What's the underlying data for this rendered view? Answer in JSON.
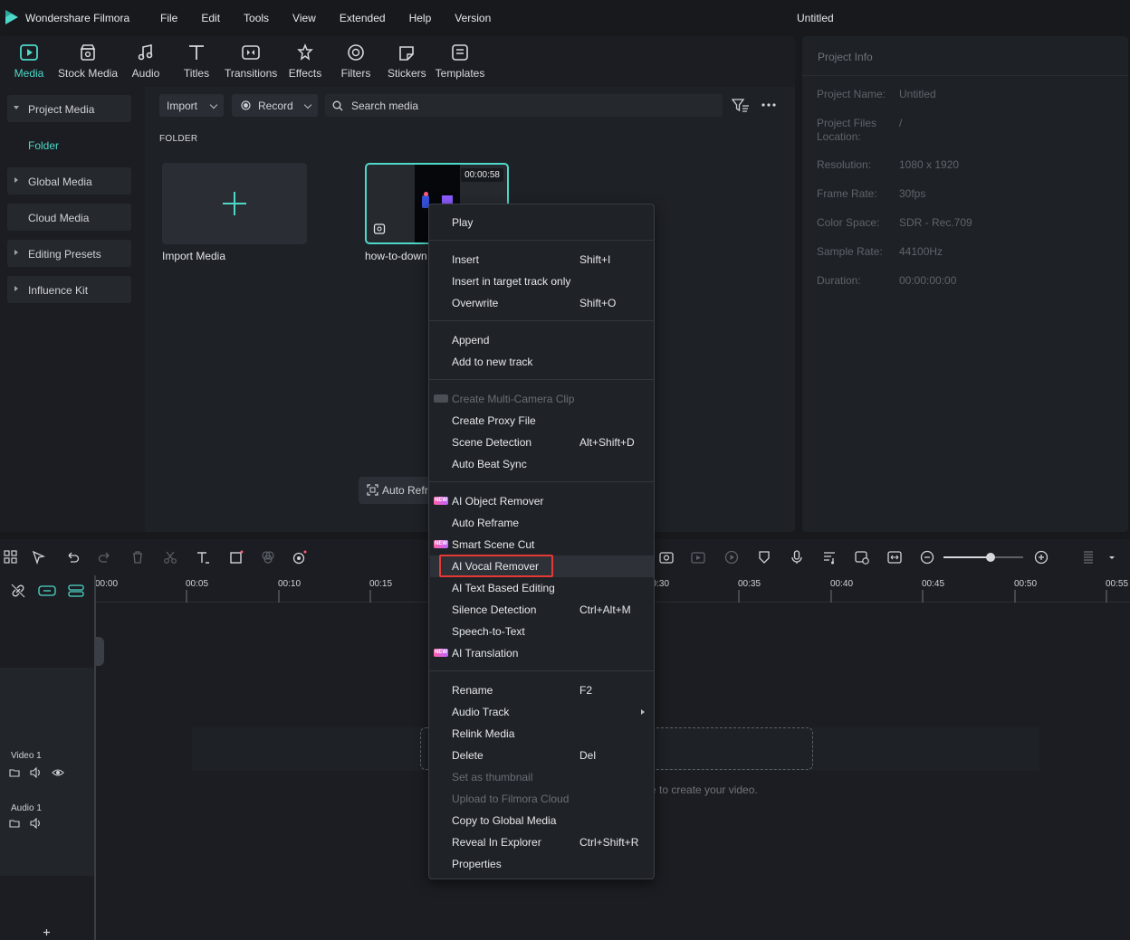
{
  "titlebar": {
    "app_name": "Wondershare Filmora",
    "menu": [
      "File",
      "Edit",
      "Tools",
      "View",
      "Extended",
      "Help",
      "Version"
    ],
    "window_title": "Untitled"
  },
  "toolbar": {
    "tools": [
      {
        "label": "Media",
        "icon": "media-icon",
        "active": true
      },
      {
        "label": "Stock Media",
        "icon": "stock-media-icon"
      },
      {
        "label": "Audio",
        "icon": "audio-note-icon"
      },
      {
        "label": "Titles",
        "icon": "titles-t-icon"
      },
      {
        "label": "Transitions",
        "icon": "transitions-icon"
      },
      {
        "label": "Effects",
        "icon": "effects-icon"
      },
      {
        "label": "Filters",
        "icon": "filters-icon"
      },
      {
        "label": "Stickers",
        "icon": "stickers-icon"
      },
      {
        "label": "Templates",
        "icon": "templates-icon"
      }
    ]
  },
  "sidebar": {
    "project_media": "Project Media",
    "folder": "Folder",
    "global_media": "Global Media",
    "cloud_media": "Cloud Media",
    "editing_presets": "Editing Presets",
    "influence_kit": "Influence Kit"
  },
  "media_area": {
    "import_label": "Import",
    "record_label": "Record",
    "search_placeholder": "Search media",
    "folder_heading": "FOLDER",
    "import_media_label": "Import Media",
    "clip_name": "how-to-down",
    "clip_duration": "00:00:58",
    "auto_reframe": "Auto Refra"
  },
  "project_info": {
    "heading": "Project Info",
    "rows": [
      {
        "key": "Project Name:",
        "value": "Untitled"
      },
      {
        "key": "Project Files Location:",
        "value": "/"
      },
      {
        "key": "Resolution:",
        "value": "1080 x 1920"
      },
      {
        "key": "Frame Rate:",
        "value": "30fps"
      },
      {
        "key": "Color Space:",
        "value": "SDR - Rec.709"
      },
      {
        "key": "Sample Rate:",
        "value": "44100Hz"
      },
      {
        "key": "Duration:",
        "value": "00:00:00:00"
      }
    ]
  },
  "timeline": {
    "ruler": [
      "00:00",
      "00:05",
      "00:10",
      "00:15",
      "00:30",
      "00:35",
      "00:40",
      "00:45",
      "00:50",
      "00:55"
    ],
    "video_track": "Video 1",
    "audio_track": "Audio 1",
    "hint": "e to create your video."
  },
  "context_menu": {
    "items": [
      {
        "label": "Play"
      },
      {
        "label": "Insert",
        "shortcut": "Shift+I"
      },
      {
        "label": "Insert in target track only"
      },
      {
        "label": "Overwrite",
        "shortcut": "Shift+O"
      },
      {
        "label": "Append"
      },
      {
        "label": "Add to new track"
      },
      {
        "label": "Create Multi-Camera Clip",
        "disabled": true
      },
      {
        "label": "Create Proxy File"
      },
      {
        "label": "Scene Detection",
        "shortcut": "Alt+Shift+D"
      },
      {
        "label": "Auto Beat Sync"
      },
      {
        "label": "AI Object Remover",
        "badge": "NEW"
      },
      {
        "label": "Auto Reframe"
      },
      {
        "label": "Smart Scene Cut",
        "badge": "NEW"
      },
      {
        "label": "AI Vocal Remover",
        "highlighted": true
      },
      {
        "label": "AI Text Based Editing"
      },
      {
        "label": "Silence Detection",
        "shortcut": "Ctrl+Alt+M"
      },
      {
        "label": "Speech-to-Text"
      },
      {
        "label": "AI Translation",
        "badge": "NEW"
      },
      {
        "label": "Rename",
        "shortcut": "F2"
      },
      {
        "label": "Audio Track",
        "submenu": true
      },
      {
        "label": "Relink Media"
      },
      {
        "label": "Delete",
        "shortcut": "Del"
      },
      {
        "label": "Set as thumbnail",
        "disabled": true
      },
      {
        "label": "Upload to Filmora Cloud",
        "disabled": true
      },
      {
        "label": "Copy to Global Media"
      },
      {
        "label": "Reveal In Explorer",
        "shortcut": "Ctrl+Shift+R"
      },
      {
        "label": "Properties"
      }
    ]
  },
  "colors": {
    "accent": "#4ed8c9",
    "highlight_box": "#e53935",
    "new_badge": "#ff5fa8"
  }
}
